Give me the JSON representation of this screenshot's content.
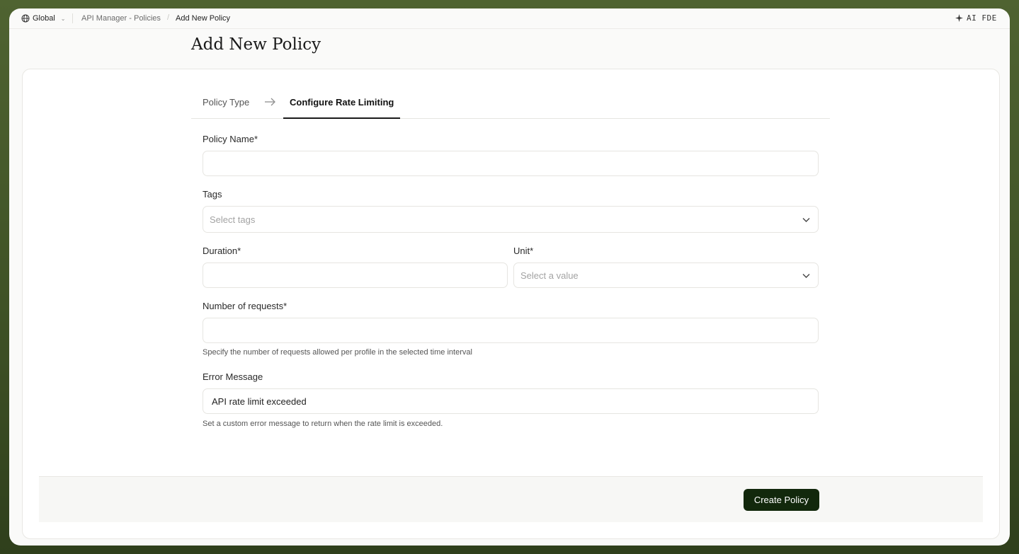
{
  "breadcrumb": {
    "scope": "Global",
    "parent": "API Manager - Policies",
    "current": "Add New Policy"
  },
  "ai_button": {
    "label": "AI FDE"
  },
  "page_title": "Add New Policy",
  "tabs": [
    {
      "label": "Policy Type",
      "active": false
    },
    {
      "label": "Configure Rate Limiting",
      "active": true
    }
  ],
  "form": {
    "policy_name": {
      "label": "Policy Name*",
      "value": "",
      "placeholder": ""
    },
    "tags": {
      "label": "Tags",
      "placeholder": "Select tags"
    },
    "duration": {
      "label": "Duration*",
      "value": ""
    },
    "unit": {
      "label": "Unit*",
      "placeholder": "Select a value"
    },
    "num_requests": {
      "label": "Number of requests*",
      "value": "",
      "hint": "Specify the number of requests allowed per profile in the selected time interval"
    },
    "error_message": {
      "label": "Error Message",
      "value": "API rate limit exceeded",
      "hint": "Set a custom error message to return when the rate limit is exceeded."
    }
  },
  "footer": {
    "create_label": "Create Policy"
  },
  "colors": {
    "primary_button": "#12280c",
    "frame_background": "#4a5d2e",
    "page_background": "#fafaf9"
  },
  "icons": {
    "scope": "globe-icon",
    "scope_dropdown": "chevron-down-icon",
    "ai": "sparkle-icon",
    "tab_separator": "arrow-right-icon",
    "select": "chevron-down-icon"
  }
}
